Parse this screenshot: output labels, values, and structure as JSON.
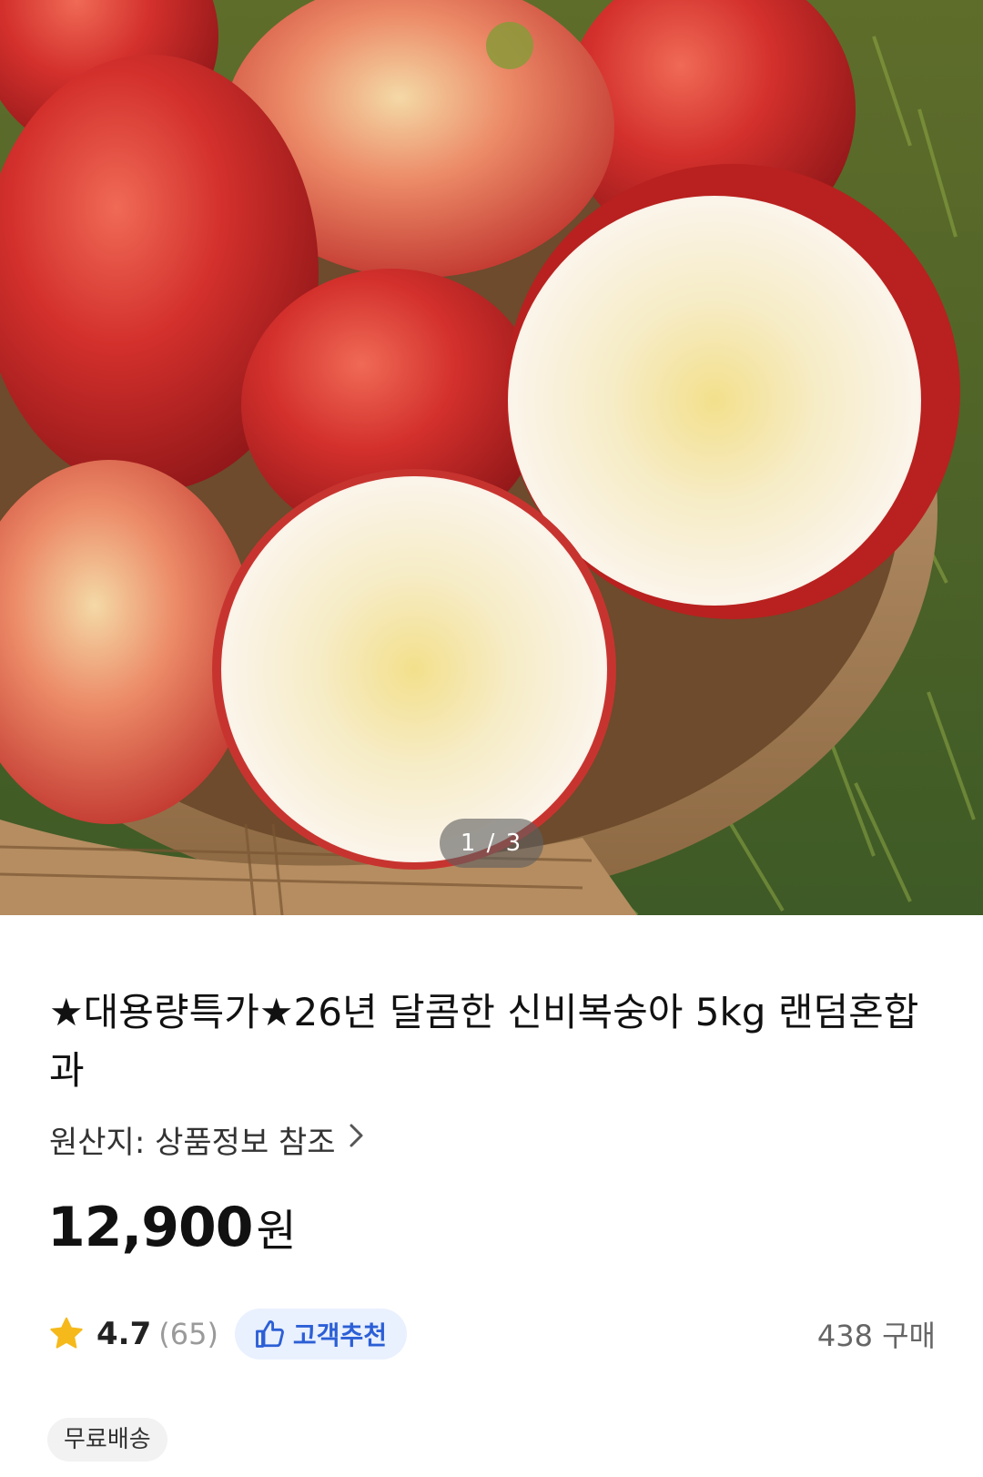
{
  "product": {
    "image_alt": "신비복숭아",
    "image_counter": "1 / 3",
    "title": "★대용량특가★26년 달콤한 신비복숭아 5kg 랜덤혼합과",
    "origin_label": "원산지: 상품정보 참조",
    "price_amount": "12,900",
    "price_unit": "원",
    "rating": "4.7",
    "review_count": "(65)",
    "recommend_label": "고객추천",
    "purchase_count": "438 구매",
    "shipping_badge": "무료배송"
  },
  "colors": {
    "star": "#f5b91b",
    "recommend_text": "#2c5fd6",
    "recommend_bg": "#e9f0fe",
    "badge_bg": "#f2f2f2"
  },
  "icons": {
    "origin_link": "chevron-right-icon",
    "rating": "star-icon",
    "recommend": "thumbs-up-icon"
  }
}
